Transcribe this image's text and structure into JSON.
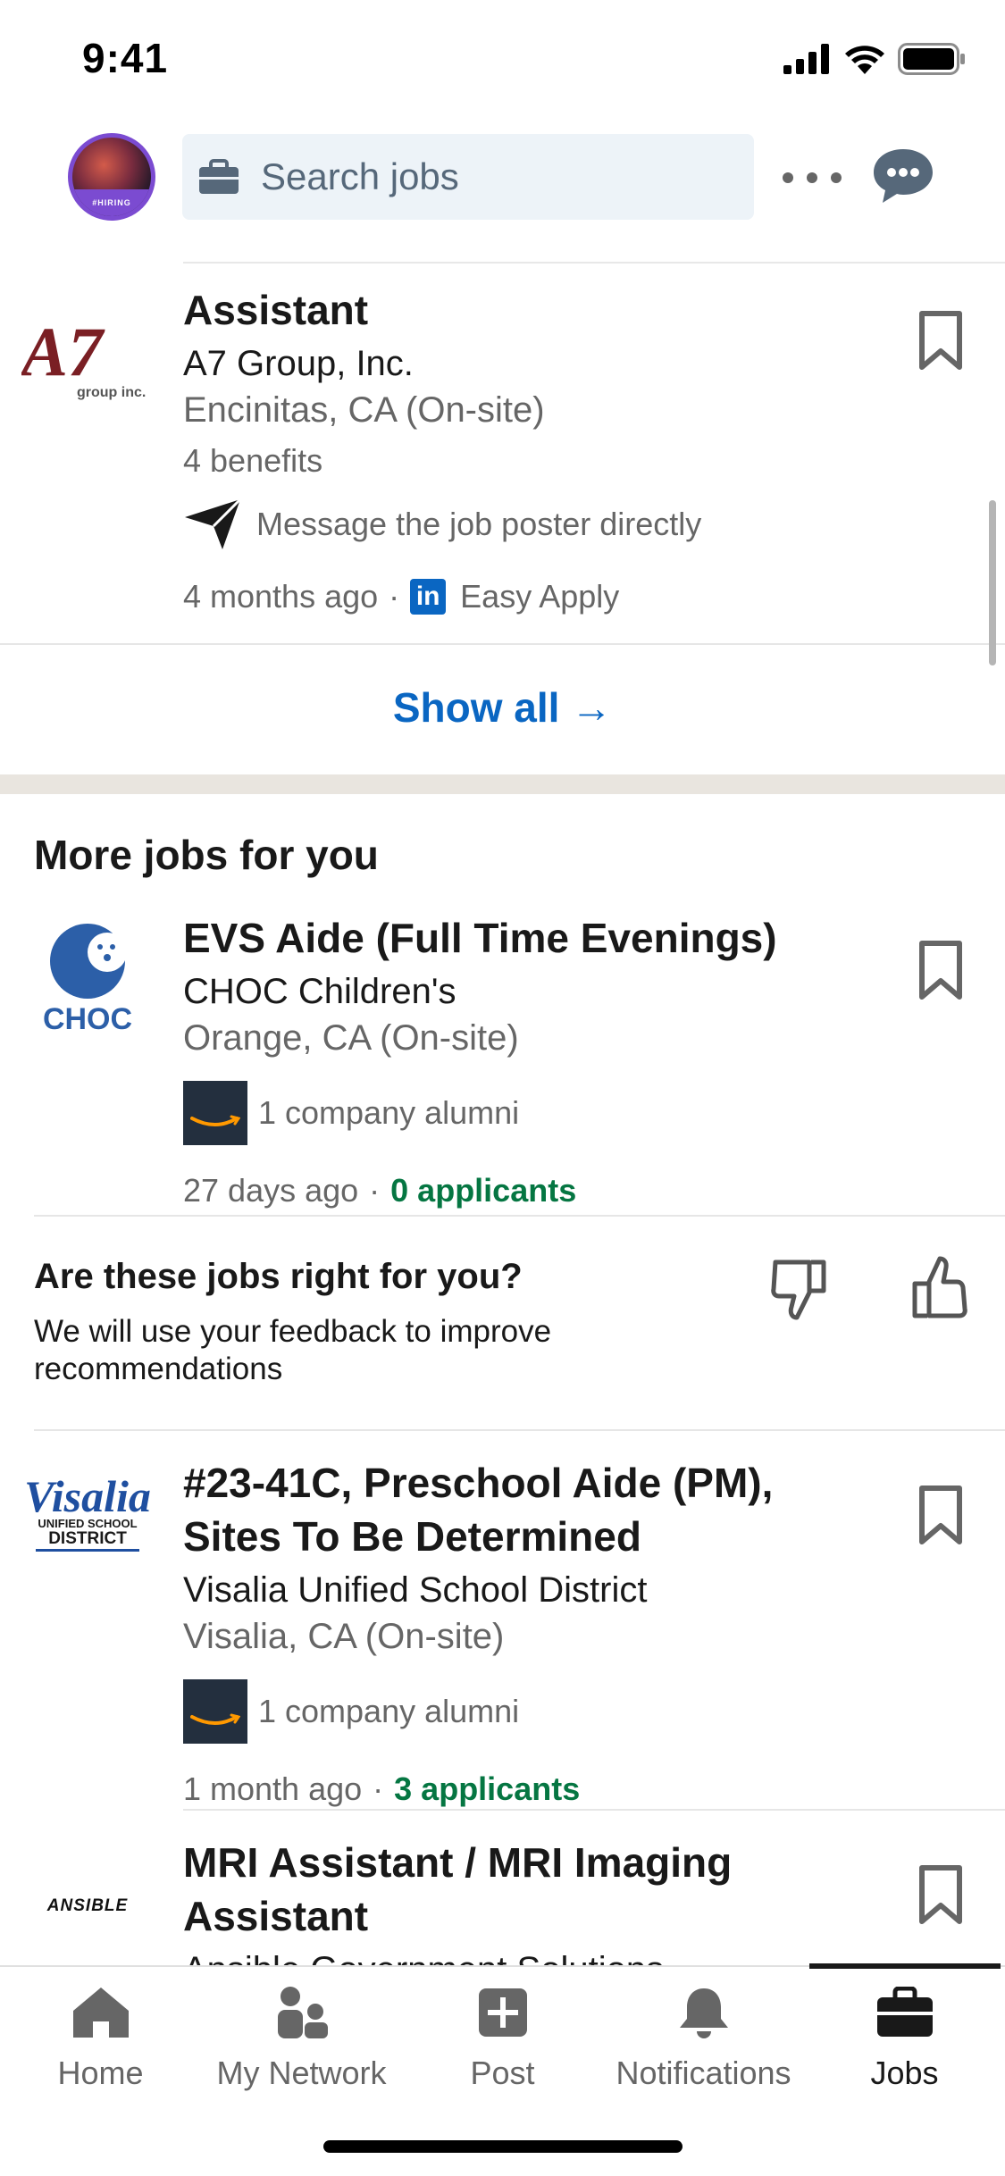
{
  "status": {
    "time": "9:41"
  },
  "header": {
    "search_placeholder": "Search jobs",
    "avatar_badge": "#HIRING"
  },
  "peek": {
    "text": "Easy Apply"
  },
  "jobs_top": [
    {
      "title": "Assistant",
      "company": "A7 Group, Inc.",
      "location": "Encinitas, CA (On-site)",
      "benefits": "4 benefits",
      "message": "Message the job poster directly",
      "posted": "4 months ago",
      "apply": "Easy Apply",
      "logo_text": "A7",
      "logo_sub": "group inc."
    }
  ],
  "show_all": "Show all →",
  "section_title": "More jobs for you",
  "jobs": [
    {
      "title": "EVS Aide (Full Time Evenings)",
      "company": "CHOC Children's",
      "location": "Orange, CA (On-site)",
      "alumni": "1 company alumni",
      "posted": "27 days ago",
      "applicants": "0 applicants",
      "logo_text": "CHOC"
    },
    {
      "title": "#23-41C, Preschool Aide (PM), Sites To Be Determined",
      "company": "Visalia Unified School District",
      "location": "Visalia, CA (On-site)",
      "alumni": "1 company alumni",
      "posted": "1 month ago",
      "applicants": "3 applicants",
      "logo_text": "Visalia",
      "logo_sub1": "UNIFIED SCHOOL",
      "logo_sub2": "DISTRICT"
    },
    {
      "title": "MRI Assistant / MRI Imaging Assistant",
      "company": "Ansible Government Solutions",
      "logo_text": "ANSIBLE"
    }
  ],
  "feedback": {
    "title": "Are these jobs right for you?",
    "subtitle": "We will use your feedback to improve recommendations"
  },
  "tabs": [
    {
      "label": "Home"
    },
    {
      "label": "My Network"
    },
    {
      "label": "Post"
    },
    {
      "label": "Notifications"
    },
    {
      "label": "Jobs"
    }
  ],
  "colors": {
    "accent": "#0a66c2",
    "applicants_green": "#057642",
    "section_gap": "#e9e5df"
  }
}
